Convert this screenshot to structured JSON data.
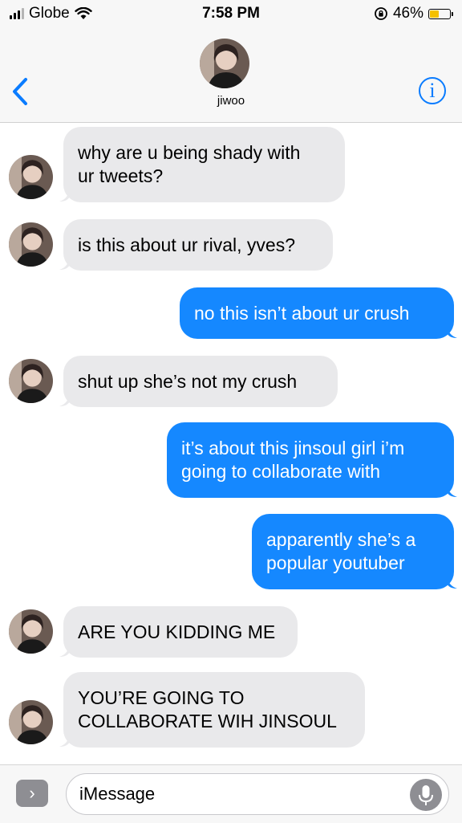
{
  "status_bar": {
    "carrier": "Globe",
    "time": "7:58 PM",
    "battery_percent": "46%",
    "battery_level": 0.46,
    "icons": [
      "signal-icon",
      "wifi-icon",
      "rotation-lock-icon",
      "battery-icon"
    ]
  },
  "header": {
    "contact_name": "jiwoo",
    "back_icon": "chevron-left-icon",
    "info_icon": "info-icon",
    "info_glyph": "i"
  },
  "messages": [
    {
      "direction": "in",
      "lines": [
        "why are u being shady with",
        "ur tweets?"
      ]
    },
    {
      "direction": "in",
      "lines": [
        "is this about ur rival, yves?"
      ]
    },
    {
      "direction": "out",
      "lines": [
        "no this isn’t about ur crush"
      ]
    },
    {
      "direction": "in",
      "lines": [
        "shut up she’s not my crush"
      ]
    },
    {
      "direction": "out",
      "lines": [
        "it’s about this jinsoul girl i’m",
        "going to collaborate with"
      ]
    },
    {
      "direction": "out",
      "lines": [
        "apparently she’s a",
        "popular youtuber"
      ]
    },
    {
      "direction": "in",
      "lines": [
        "ARE YOU KIDDING ME"
      ]
    },
    {
      "direction": "in",
      "lines": [
        "YOU’RE GOING TO",
        "COLLABORATE WIH JINSOUL"
      ]
    }
  ],
  "input_bar": {
    "apps_glyph": "›",
    "placeholder": "iMessage",
    "apps_icon": "app-store-icon",
    "mic_icon": "microphone-icon"
  },
  "colors": {
    "outgoing_bubble": "#1588ff",
    "incoming_bubble": "#e9e9eb",
    "accent": "#0a7cff",
    "battery": "#f5c000"
  }
}
